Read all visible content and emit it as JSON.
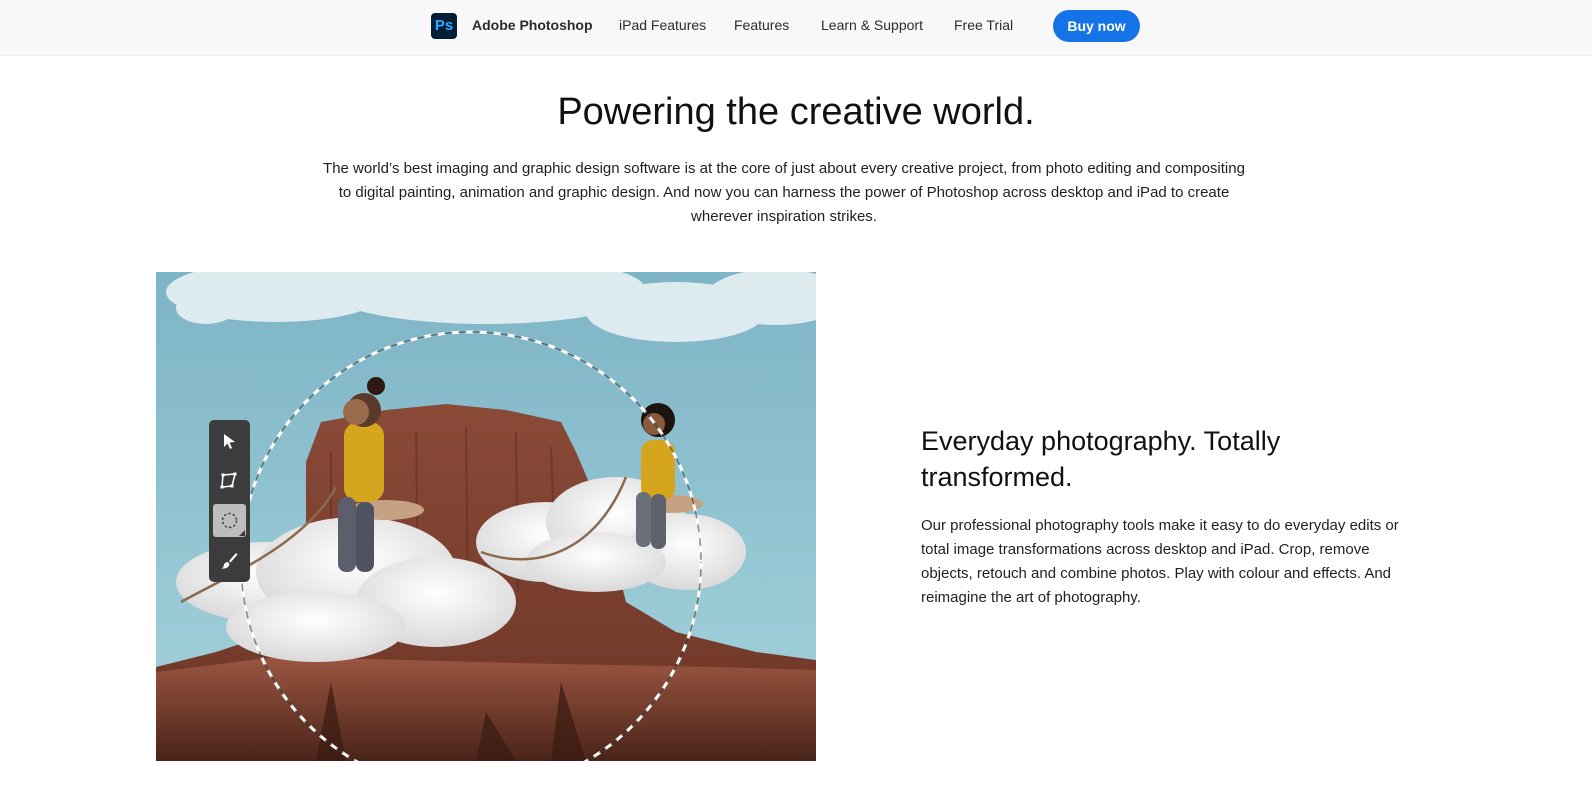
{
  "nav": {
    "logo_text": "Ps",
    "brand_name": "Adobe Photoshop",
    "links": [
      "iPad Features",
      "Features",
      "Learn & Support",
      "Free Trial"
    ],
    "cta_label": "Buy now",
    "cta_color": "#1473e6"
  },
  "hero": {
    "title": "Powering the creative world.",
    "description": "The world’s best imaging and graphic design software is at the core of just about every creative project, from photo editing and compositing to digital painting, animation and graphic design. And now you can harness the power of Photoshop across desktop and iPad to create wherever inspiration strikes."
  },
  "feature": {
    "title": "Everyday photography. Totally transformed.",
    "description": "Our professional photography tools make it easy to do everyday edits or total image transformations across desktop and iPad. Crop, remove objects, retouch and combine photos. Play with colour and effects. And reimagine the art of photography.",
    "image_tools": [
      "pointer-icon",
      "transform-icon",
      "ellipse-select-icon",
      "brush-icon"
    ],
    "active_tool": "ellipse-select-icon"
  }
}
